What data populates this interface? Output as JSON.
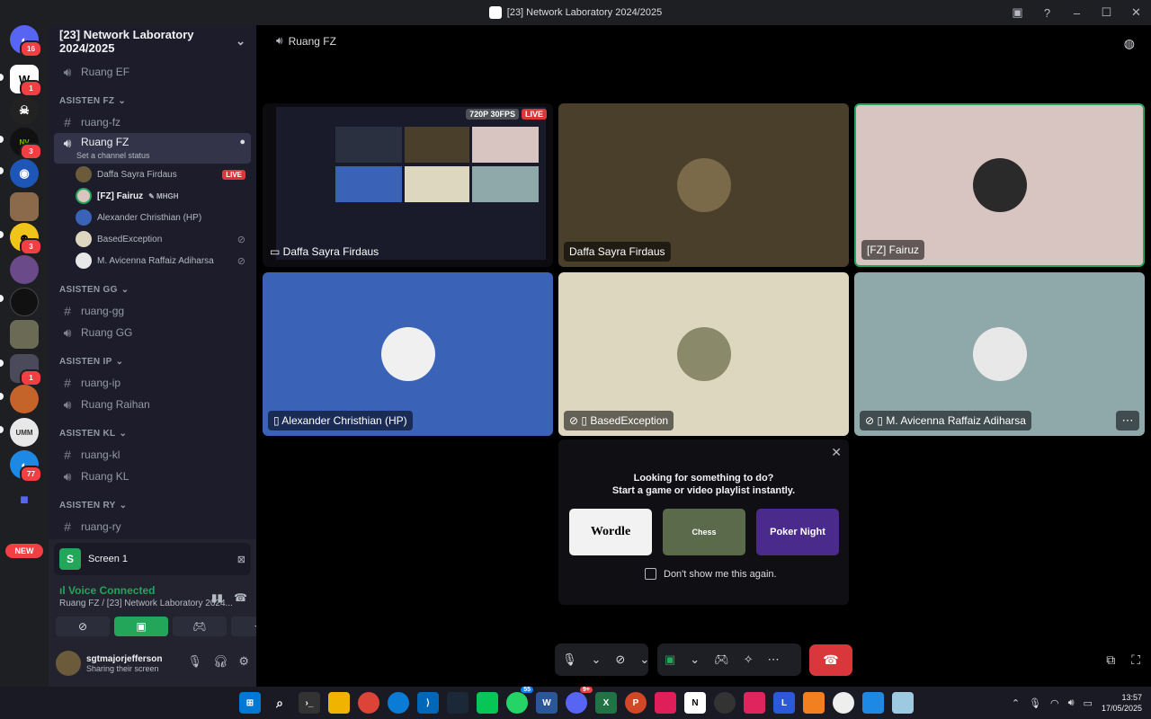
{
  "window": {
    "title": "[23] Network Laboratory 2024/2025"
  },
  "servers": [
    {
      "name": "discord-home",
      "badge": "16",
      "color": "#5865f2"
    },
    {
      "name": "server-w",
      "badge": "1",
      "color": "#ffffff"
    },
    {
      "name": "server-skull",
      "badge": "",
      "color": "#222222"
    },
    {
      "name": "server-nvidia",
      "badge": "3",
      "color": "#1a1a1a"
    },
    {
      "name": "server-blue",
      "badge": "",
      "color": "#1e56b8"
    },
    {
      "name": "server-castle",
      "badge": "",
      "color": "#8a6a4a"
    },
    {
      "name": "server-yellow",
      "badge": "3",
      "color": "#f0c419"
    },
    {
      "name": "server-anime",
      "badge": "",
      "color": "#6b4a8a"
    },
    {
      "name": "server-dark",
      "badge": "",
      "color": "#111111"
    },
    {
      "name": "server-figure",
      "badge": "",
      "color": "#6b6b55"
    },
    {
      "name": "server-char",
      "badge": "1",
      "color": "#4a4a5a"
    },
    {
      "name": "server-orange",
      "badge": "",
      "color": "#c4632a"
    },
    {
      "name": "server-white",
      "badge": "",
      "color": "#e8e8e8"
    },
    {
      "name": "server-discord-blue",
      "badge": "77",
      "color": "#1e88e5"
    },
    {
      "name": "server-folder",
      "badge": "",
      "color": "#5865f2"
    }
  ],
  "new_label": "NEW",
  "guild": {
    "name": "[23] Network Laboratory 2024/2025"
  },
  "channels": {
    "ruang_ef": "Ruang EF",
    "cat_fz": "ASISTEN FZ",
    "ruang_fz_text": "ruang-fz",
    "ruang_fz_voice": "Ruang FZ",
    "ruang_fz_status": "Set a channel status",
    "members": [
      {
        "name": "Daffa Sayra Firdaus",
        "tag": "LIVE"
      },
      {
        "name": "[FZ] Fairuz",
        "tag": "MHGH"
      },
      {
        "name": "Alexander Christhian (HP)",
        "tag": ""
      },
      {
        "name": "BasedException",
        "tag": ""
      },
      {
        "name": "M. Avicenna Raffaiz Adiharsa",
        "tag": ""
      }
    ],
    "cat_gg": "ASISTEN GG",
    "ruang_gg_text": "ruang-gg",
    "ruang_gg_voice": "Ruang GG",
    "cat_ip": "ASISTEN IP",
    "ruang_ip_text": "ruang-ip",
    "ruang_raihan": "Ruang Raihan",
    "cat_kl": "ASISTEN KL",
    "ruang_kl_text": "ruang-kl",
    "ruang_kl_voice": "Ruang KL",
    "cat_ry": "ASISTEN RY",
    "ruang_ry_text": "ruang-ry"
  },
  "panel": {
    "screen_label": "Screen 1",
    "screen_initial": "S",
    "voice_status": "Voice Connected",
    "voice_location": "Ruang FZ / [23] Network Laboratory 2024...",
    "username": "sgtmajorjefferson",
    "user_status": "Sharing their screen"
  },
  "main": {
    "channel_title": "Ruang FZ",
    "stream_quality": "720P 30FPS",
    "live_label": "LIVE",
    "tiles": [
      {
        "name": "Daffa Sayra Firdaus",
        "bg": "#0b0b10"
      },
      {
        "name": "Daffa Sayra Firdaus",
        "bg": "#4a3f2a"
      },
      {
        "name": "[FZ] Fairuz",
        "bg": "#d8c4c0"
      },
      {
        "name": "Alexander Christhian (HP)",
        "bg": "#3a63b8"
      },
      {
        "name": "BasedException",
        "bg": "#ddd7bf"
      },
      {
        "name": "M. Avicenna Raffaiz Adiharsa",
        "bg": "#8fa9ab"
      }
    ]
  },
  "activity": {
    "line1": "Looking for something to do?",
    "line2": "Start a game or video playlist instantly.",
    "games": [
      "Wordle",
      "Chess",
      "Poker Night"
    ],
    "dont_show": "Don't show me this again."
  },
  "taskbar": {
    "time": "13:57",
    "date": "17/05/2025",
    "whatsapp_badge": "55",
    "discord_badge": "9+"
  }
}
